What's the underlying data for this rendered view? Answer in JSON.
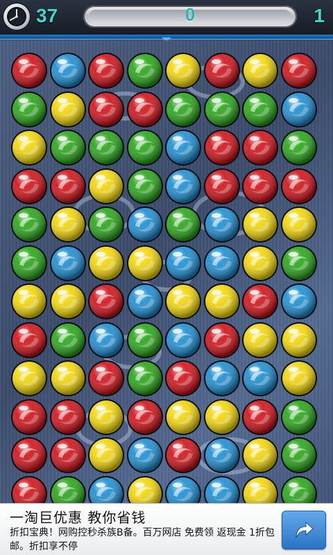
{
  "hud": {
    "time_left": "37",
    "score": "0",
    "level": "1",
    "progress_fraction": 0
  },
  "board": {
    "rows": [
      [
        "red",
        "blue",
        "red",
        "green",
        "yellow",
        "red",
        "yellow",
        "red"
      ],
      [
        "green",
        "yellow",
        "red",
        "red",
        "green",
        "green",
        "green",
        "blue"
      ],
      [
        "yellow",
        "green",
        "green",
        "green",
        "blue",
        "red",
        "red",
        "green"
      ],
      [
        "red",
        "red",
        "yellow",
        "green",
        "blue",
        "red",
        "red",
        "red"
      ],
      [
        "green",
        "yellow",
        "green",
        "blue",
        "green",
        "blue",
        "yellow",
        "yellow"
      ],
      [
        "green",
        "blue",
        "yellow",
        "yellow",
        "blue",
        "blue",
        "yellow",
        "green"
      ],
      [
        "yellow",
        "yellow",
        "red",
        "blue",
        "yellow",
        "yellow",
        "red",
        "blue"
      ],
      [
        "red",
        "green",
        "blue",
        "green",
        "blue",
        "red",
        "yellow",
        "yellow"
      ],
      [
        "yellow",
        "yellow",
        "red",
        "green",
        "red",
        "blue",
        "blue",
        "yellow"
      ],
      [
        "red",
        "red",
        "yellow",
        "red",
        "yellow",
        "yellow",
        "red",
        "green"
      ],
      [
        "red",
        "red",
        "yellow",
        "blue",
        "red",
        "blue",
        "yellow",
        "green"
      ],
      [
        "red",
        "green",
        "blue",
        "yellow",
        "blue",
        "blue",
        "yellow",
        "green"
      ]
    ],
    "colors": {
      "red": "#d0141a",
      "blue": "#1e8fd2",
      "green": "#2aa61a",
      "yellow": "#f2d60a"
    }
  },
  "ad": {
    "title": "一淘巨优惠 教你省钱",
    "body": "折扣宝典！网购控秒杀族B备。百万网店 免费领 返现金 1折包邮。折扣享不停",
    "button_icon": "share-arrow-icon"
  }
}
